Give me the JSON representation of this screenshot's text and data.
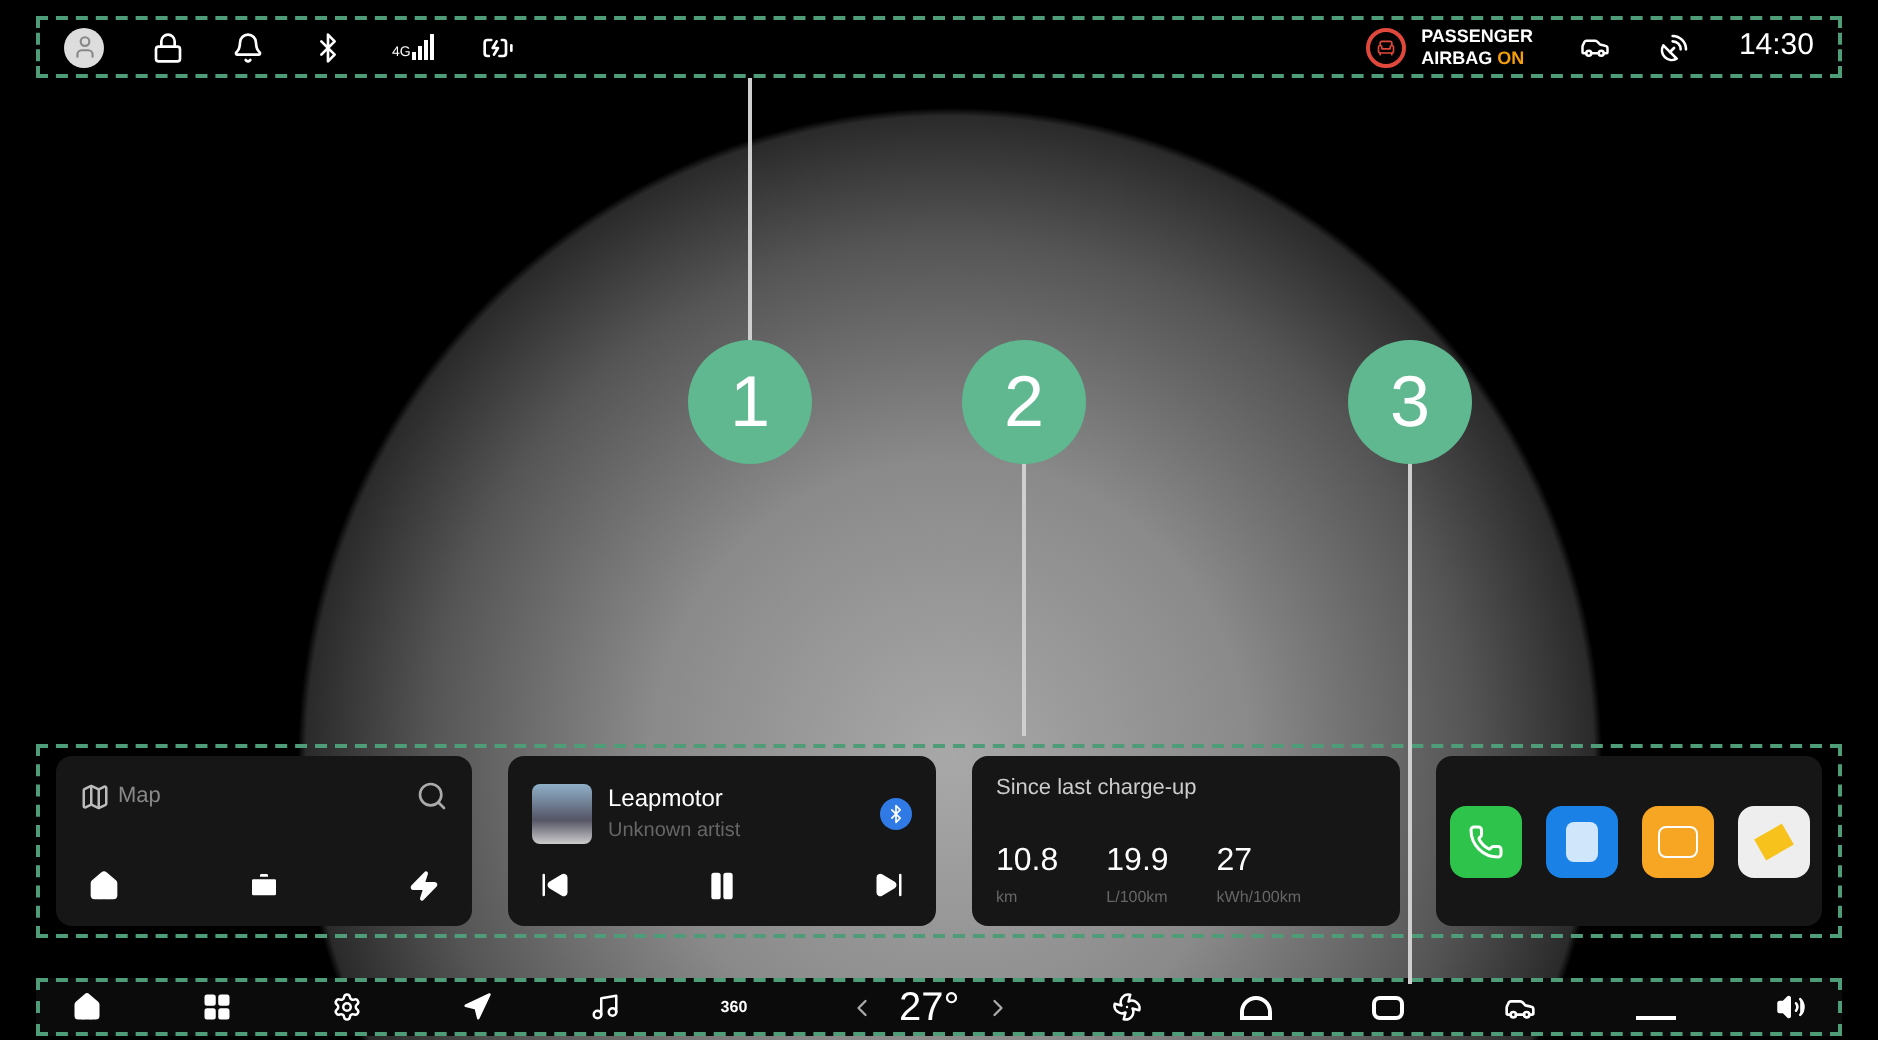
{
  "status_bar": {
    "network": "4G",
    "airbag": {
      "line1": "PASSENGER",
      "line2": "AIRBAG",
      "state": "ON"
    },
    "time": "14:30"
  },
  "callouts": [
    "1",
    "2",
    "3"
  ],
  "map_card": {
    "title": "Map"
  },
  "media_card": {
    "title": "Leapmotor",
    "artist": "Unknown artist",
    "playing": true
  },
  "trip_card": {
    "title": "Since last charge-up",
    "stats": [
      {
        "value": "10.8",
        "unit": "km"
      },
      {
        "value": "19.9",
        "unit": "L/100km"
      },
      {
        "value": "27",
        "unit": "kWh/100km"
      }
    ]
  },
  "dock": {
    "camera_label": "360",
    "temperature": "27°"
  }
}
